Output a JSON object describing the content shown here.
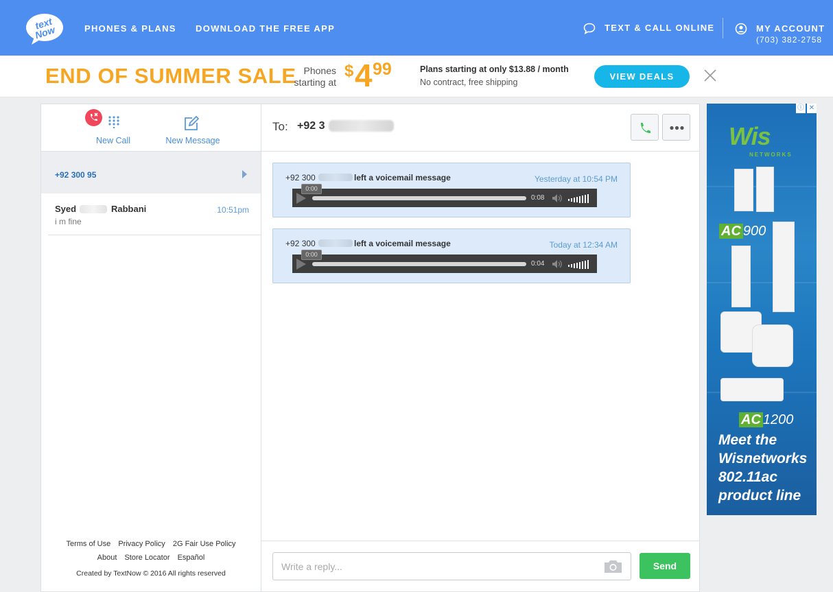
{
  "topnav": {
    "logo_text": "textNow",
    "links": [
      "PHONES & PLANS",
      "DOWNLOAD THE FREE APP"
    ],
    "text_call_online": "TEXT & CALL ONLINE",
    "my_account": "MY ACCOUNT",
    "account_phone": "(703) 382-2758",
    "bg_color": "#4d8ef0"
  },
  "banner": {
    "sale_title": "END OF SUMMER SALE",
    "phones_line1": "Phones",
    "phones_line2": "starting at",
    "price_symbol": "$",
    "price_main": "4",
    "price_cents": "99",
    "plans_line1": "Plans starting at only $13.88 / month",
    "plans_line2": "No contract, free shipping",
    "cta": "VIEW DEALS",
    "accent": "#f6a623",
    "cta_color": "#16b6e8"
  },
  "sidebar": {
    "new_call_label": "New Call",
    "new_message_label": "New Message",
    "active_conversation": "+92 300 95",
    "conversations": [
      {
        "name_first": "Syed",
        "name_last": "Rabbani",
        "time": "10:51pm",
        "preview": "i m fine"
      }
    ],
    "footer_row1": [
      "Terms of Use",
      "Privacy Policy",
      "2G Fair Use Policy"
    ],
    "footer_row2": [
      "About",
      "Store Locator",
      "Español"
    ],
    "copyright": "Created by TextNow © 2016 All rights reserved"
  },
  "chat": {
    "to_label": "To:",
    "to_number": "+92 3",
    "messages": [
      {
        "from": "+92 300",
        "text": "left a voicemail message",
        "time": "Yesterday at 10:54 PM",
        "current": "0:00",
        "duration": "0:08"
      },
      {
        "from": "+92 300",
        "text": "left a voicemail message",
        "time": "Today at 12:34 AM",
        "current": "0:00",
        "duration": "0:04"
      }
    ],
    "reply_placeholder": "Write a reply...",
    "send_label": "Send",
    "send_color": "#3cc25e"
  },
  "ad": {
    "logo": "Wis",
    "logo_sub": "NETWORKS",
    "product1_box": "AC",
    "product1_num": "900",
    "product2_box": "AC",
    "product2_num": "1200",
    "tagline": "Meet the Wisnetworks 802.11ac product line"
  }
}
